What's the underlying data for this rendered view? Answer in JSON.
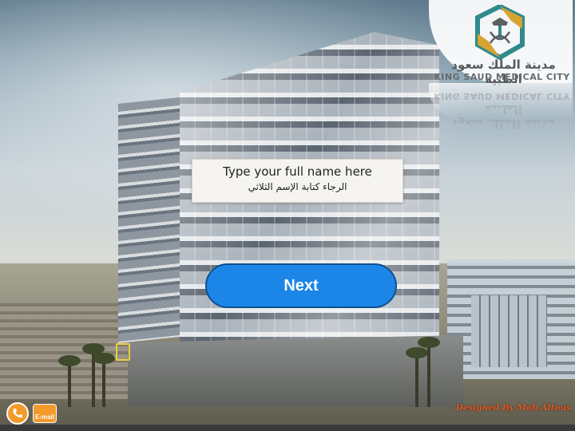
{
  "logo": {
    "name_ar": "مدينة الملك سعود الطبية",
    "name_en": "KING SAUD MEDICAL CITY",
    "colors": {
      "teal": "#2f8a8c",
      "gold": "#d8a431",
      "gray": "#5b6063"
    }
  },
  "name_prompt": {
    "line_en": "Type your full name here",
    "line_ar": "الرجاء كتابة الإسم الثلاثي"
  },
  "next_button": {
    "label": "Next",
    "color": "#1c86e8"
  },
  "footer": {
    "phone_icon": "phone-icon",
    "email_label": "E-mail",
    "credit": "Designed By Moh.Altous"
  }
}
